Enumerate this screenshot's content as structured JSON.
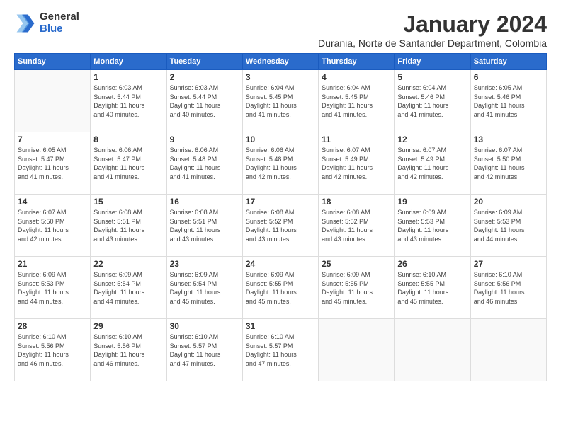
{
  "logo": {
    "general": "General",
    "blue": "Blue"
  },
  "title": "January 2024",
  "subtitle": "Durania, Norte de Santander Department, Colombia",
  "days_of_week": [
    "Sunday",
    "Monday",
    "Tuesday",
    "Wednesday",
    "Thursday",
    "Friday",
    "Saturday"
  ],
  "weeks": [
    [
      {
        "day": "",
        "info": ""
      },
      {
        "day": "1",
        "info": "Sunrise: 6:03 AM\nSunset: 5:44 PM\nDaylight: 11 hours\nand 40 minutes."
      },
      {
        "day": "2",
        "info": "Sunrise: 6:03 AM\nSunset: 5:44 PM\nDaylight: 11 hours\nand 40 minutes."
      },
      {
        "day": "3",
        "info": "Sunrise: 6:04 AM\nSunset: 5:45 PM\nDaylight: 11 hours\nand 41 minutes."
      },
      {
        "day": "4",
        "info": "Sunrise: 6:04 AM\nSunset: 5:45 PM\nDaylight: 11 hours\nand 41 minutes."
      },
      {
        "day": "5",
        "info": "Sunrise: 6:04 AM\nSunset: 5:46 PM\nDaylight: 11 hours\nand 41 minutes."
      },
      {
        "day": "6",
        "info": "Sunrise: 6:05 AM\nSunset: 5:46 PM\nDaylight: 11 hours\nand 41 minutes."
      }
    ],
    [
      {
        "day": "7",
        "info": "Sunrise: 6:05 AM\nSunset: 5:47 PM\nDaylight: 11 hours\nand 41 minutes."
      },
      {
        "day": "8",
        "info": "Sunrise: 6:06 AM\nSunset: 5:47 PM\nDaylight: 11 hours\nand 41 minutes."
      },
      {
        "day": "9",
        "info": "Sunrise: 6:06 AM\nSunset: 5:48 PM\nDaylight: 11 hours\nand 41 minutes."
      },
      {
        "day": "10",
        "info": "Sunrise: 6:06 AM\nSunset: 5:48 PM\nDaylight: 11 hours\nand 42 minutes."
      },
      {
        "day": "11",
        "info": "Sunrise: 6:07 AM\nSunset: 5:49 PM\nDaylight: 11 hours\nand 42 minutes."
      },
      {
        "day": "12",
        "info": "Sunrise: 6:07 AM\nSunset: 5:49 PM\nDaylight: 11 hours\nand 42 minutes."
      },
      {
        "day": "13",
        "info": "Sunrise: 6:07 AM\nSunset: 5:50 PM\nDaylight: 11 hours\nand 42 minutes."
      }
    ],
    [
      {
        "day": "14",
        "info": "Sunrise: 6:07 AM\nSunset: 5:50 PM\nDaylight: 11 hours\nand 42 minutes."
      },
      {
        "day": "15",
        "info": "Sunrise: 6:08 AM\nSunset: 5:51 PM\nDaylight: 11 hours\nand 43 minutes."
      },
      {
        "day": "16",
        "info": "Sunrise: 6:08 AM\nSunset: 5:51 PM\nDaylight: 11 hours\nand 43 minutes."
      },
      {
        "day": "17",
        "info": "Sunrise: 6:08 AM\nSunset: 5:52 PM\nDaylight: 11 hours\nand 43 minutes."
      },
      {
        "day": "18",
        "info": "Sunrise: 6:08 AM\nSunset: 5:52 PM\nDaylight: 11 hours\nand 43 minutes."
      },
      {
        "day": "19",
        "info": "Sunrise: 6:09 AM\nSunset: 5:53 PM\nDaylight: 11 hours\nand 43 minutes."
      },
      {
        "day": "20",
        "info": "Sunrise: 6:09 AM\nSunset: 5:53 PM\nDaylight: 11 hours\nand 44 minutes."
      }
    ],
    [
      {
        "day": "21",
        "info": "Sunrise: 6:09 AM\nSunset: 5:53 PM\nDaylight: 11 hours\nand 44 minutes."
      },
      {
        "day": "22",
        "info": "Sunrise: 6:09 AM\nSunset: 5:54 PM\nDaylight: 11 hours\nand 44 minutes."
      },
      {
        "day": "23",
        "info": "Sunrise: 6:09 AM\nSunset: 5:54 PM\nDaylight: 11 hours\nand 45 minutes."
      },
      {
        "day": "24",
        "info": "Sunrise: 6:09 AM\nSunset: 5:55 PM\nDaylight: 11 hours\nand 45 minutes."
      },
      {
        "day": "25",
        "info": "Sunrise: 6:09 AM\nSunset: 5:55 PM\nDaylight: 11 hours\nand 45 minutes."
      },
      {
        "day": "26",
        "info": "Sunrise: 6:10 AM\nSunset: 5:55 PM\nDaylight: 11 hours\nand 45 minutes."
      },
      {
        "day": "27",
        "info": "Sunrise: 6:10 AM\nSunset: 5:56 PM\nDaylight: 11 hours\nand 46 minutes."
      }
    ],
    [
      {
        "day": "28",
        "info": "Sunrise: 6:10 AM\nSunset: 5:56 PM\nDaylight: 11 hours\nand 46 minutes."
      },
      {
        "day": "29",
        "info": "Sunrise: 6:10 AM\nSunset: 5:56 PM\nDaylight: 11 hours\nand 46 minutes."
      },
      {
        "day": "30",
        "info": "Sunrise: 6:10 AM\nSunset: 5:57 PM\nDaylight: 11 hours\nand 47 minutes."
      },
      {
        "day": "31",
        "info": "Sunrise: 6:10 AM\nSunset: 5:57 PM\nDaylight: 11 hours\nand 47 minutes."
      },
      {
        "day": "",
        "info": ""
      },
      {
        "day": "",
        "info": ""
      },
      {
        "day": "",
        "info": ""
      }
    ]
  ]
}
